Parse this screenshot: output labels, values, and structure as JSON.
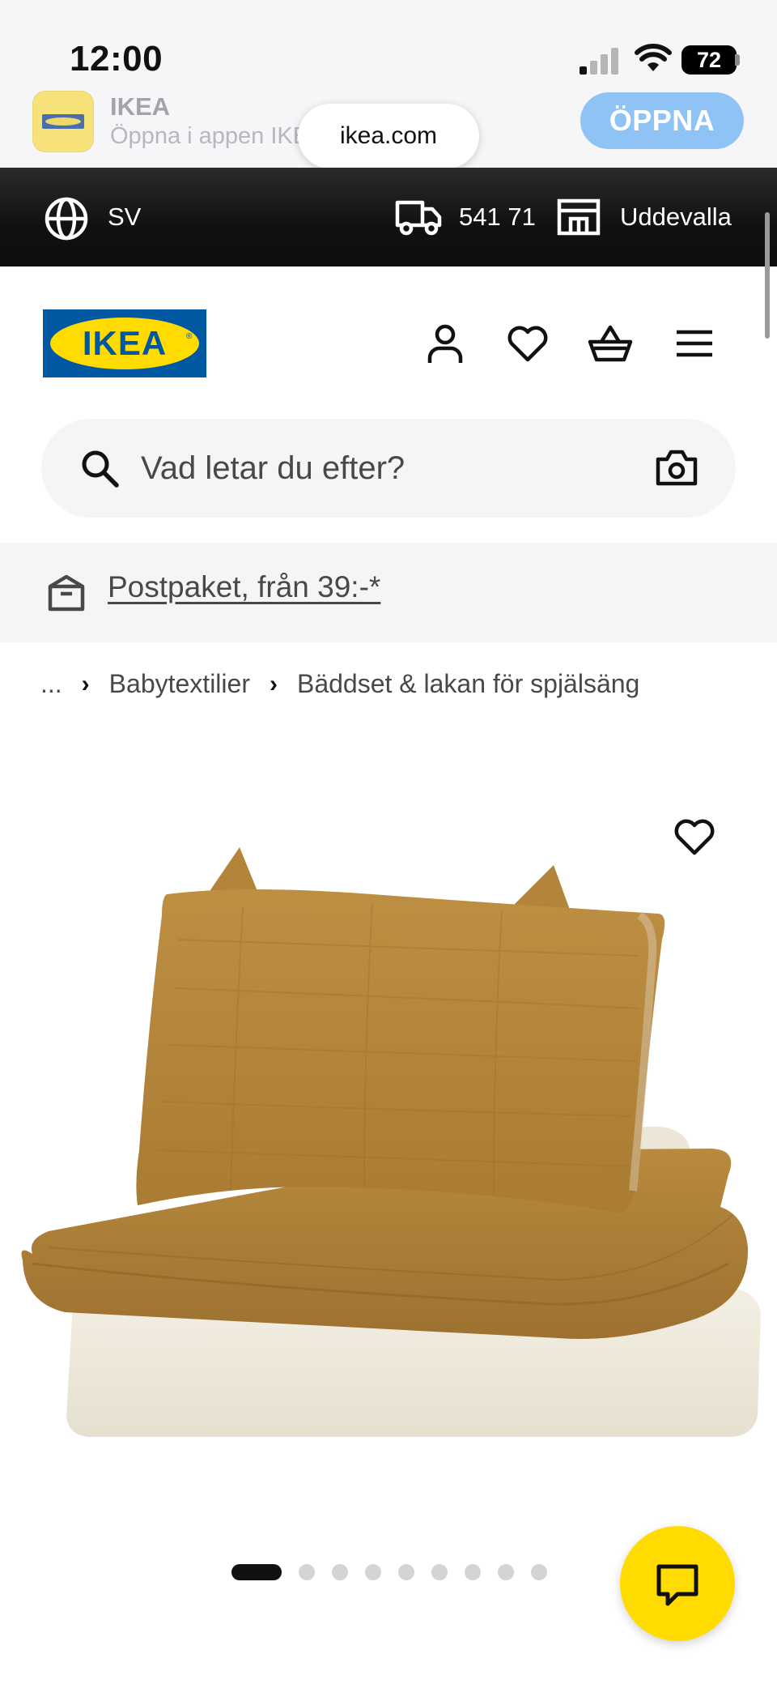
{
  "status_bar": {
    "time": "12:00",
    "battery": "72"
  },
  "app_banner": {
    "app_name": "IKEA",
    "subtitle": "Öppna i appen IKEA",
    "url": "ikea.com",
    "open_label": "ÖPPNA"
  },
  "info_bar": {
    "language": "SV",
    "postal_code": "541 71",
    "store": "Uddevalla"
  },
  "header": {
    "logo_text": "IKEA",
    "icons": [
      "profile-icon",
      "heart-icon",
      "basket-icon",
      "menu-icon"
    ]
  },
  "search": {
    "placeholder": "Vad letar du efter?"
  },
  "promo": {
    "link_text": "Postpaket, från 39:-*"
  },
  "breadcrumb": {
    "ellipsis": "...",
    "separator": "›",
    "items": [
      "Babytextilier",
      "Bäddset & lakan för spjälsäng"
    ]
  },
  "carousel": {
    "total": 9,
    "active": 1
  },
  "colors": {
    "ikea_blue": "#0058a3",
    "ikea_yellow": "#ffdb00",
    "open_button": "#8fc3f6",
    "pillow_mustard": "#b88a3f",
    "mattress_cream": "#efebdd"
  }
}
